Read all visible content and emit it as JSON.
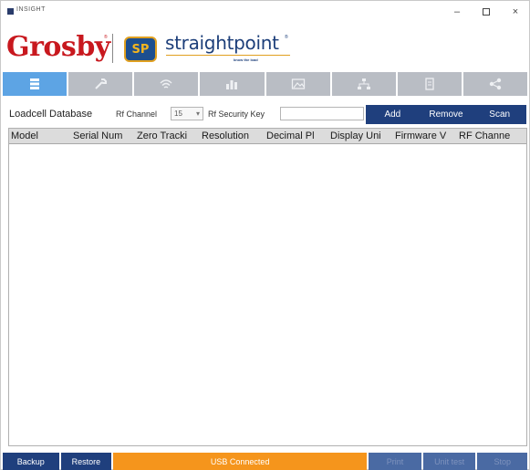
{
  "window": {
    "title": "INSIGHT",
    "minimize_glyph": "–",
    "close_glyph": "×"
  },
  "brand": {
    "crosby": "Grosby",
    "straightpoint": "straightpoint",
    "sp_badge": "SP",
    "tagline": "know the load",
    "crosby_color": "#c8181e",
    "sp_color": "#1d3f7a"
  },
  "toolbar": {
    "items": [
      {
        "icon": "database-icon",
        "active": true
      },
      {
        "icon": "wrench-icon",
        "active": false
      },
      {
        "icon": "wifi-signal-icon",
        "active": false
      },
      {
        "icon": "bar-chart-icon",
        "active": false
      },
      {
        "icon": "image-icon",
        "active": false
      },
      {
        "icon": "network-icon",
        "active": false
      },
      {
        "icon": "document-icon",
        "active": false
      },
      {
        "icon": "settings-nodes-icon",
        "active": false
      }
    ],
    "active_color": "#5da4e4",
    "inactive_color": "#b9bdc4"
  },
  "filters": {
    "db_label": "Loadcell Database",
    "rf_channel_label": "Rf Channel",
    "rf_channel_value": "15",
    "rf_key_label": "Rf Security Key",
    "rf_key_value": ""
  },
  "actions": {
    "add": "Add",
    "remove": "Remove",
    "scan": "Scan"
  },
  "table": {
    "columns": [
      "Model",
      "Serial Num",
      "Zero Tracki",
      "Resolution",
      "Decimal Pl",
      "Display Uni",
      "Firmware V",
      "RF Channe"
    ],
    "rows": []
  },
  "footer": {
    "backup": "Backup",
    "restore": "Restore",
    "status": "USB Connected",
    "status_color": "#f5951c",
    "disabled_1": "Print",
    "disabled_2": "Unit test",
    "disabled_3": "Stop"
  }
}
